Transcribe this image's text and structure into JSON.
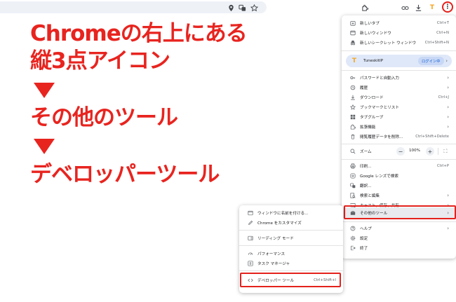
{
  "overlay": {
    "line1": "Chromeの右上にある",
    "line2": "縦3点アイコン",
    "line3": "その他のツール",
    "line4": "デベロッパーツール"
  },
  "toolbar": {
    "menu_icon_glyph": "⋮"
  },
  "menu": {
    "items_top": [
      {
        "label": "新しいタブ",
        "shortcut": "Ctrl+T",
        "icon": "new-tab-icon"
      },
      {
        "label": "新しいウィンドウ",
        "shortcut": "Ctrl+N",
        "icon": "new-window-icon"
      },
      {
        "label": "新しいシークレット ウィンドウ",
        "shortcut": "Ctrl+Shift+N",
        "icon": "incognito-icon"
      }
    ],
    "profile": {
      "name": "TuneskitIP",
      "badge": "ログイン中"
    },
    "items_mid": [
      {
        "label": "パスワードと自動入力",
        "shortcut": "",
        "arrow": "›",
        "icon": "key-icon"
      },
      {
        "label": "履歴",
        "shortcut": "",
        "arrow": "›",
        "icon": "history-icon"
      },
      {
        "label": "ダウンロード",
        "shortcut": "Ctrl+J",
        "arrow": "",
        "icon": "download-icon"
      },
      {
        "label": "ブックマークとリスト",
        "shortcut": "",
        "arrow": "›",
        "icon": "star-icon"
      },
      {
        "label": "タブグループ",
        "shortcut": "",
        "arrow": "›",
        "icon": "tab-groups-icon"
      },
      {
        "label": "拡張機能",
        "shortcut": "",
        "arrow": "›",
        "icon": "extension-icon"
      },
      {
        "label": "閲覧履歴データを削除...",
        "shortcut": "Ctrl+Shift+Delete",
        "arrow": "",
        "icon": "trash-icon"
      }
    ],
    "zoom": {
      "label": "ズーム",
      "minus": "−",
      "value": "100%",
      "plus": "+"
    },
    "items_tools": [
      {
        "label": "印刷...",
        "shortcut": "Ctrl+P",
        "arrow": "",
        "icon": "print-icon"
      },
      {
        "label": "Google レンズで検索",
        "shortcut": "",
        "arrow": "",
        "icon": "lens-icon"
      },
      {
        "label": "翻訳...",
        "shortcut": "",
        "arrow": "",
        "icon": "translate-icon"
      },
      {
        "label": "検索と編集",
        "shortcut": "",
        "arrow": "›",
        "icon": "search-edit-icon"
      },
      {
        "label": "キャスト、保存、共有",
        "shortcut": "",
        "arrow": "›",
        "icon": "cast-icon"
      },
      {
        "label": "その他のツール",
        "shortcut": "",
        "arrow": "›",
        "icon": "toolbox-icon"
      }
    ],
    "items_bottom": [
      {
        "label": "ヘルプ",
        "shortcut": "",
        "arrow": "›",
        "icon": "help-icon"
      },
      {
        "label": "設定",
        "shortcut": "",
        "arrow": "",
        "icon": "settings-icon"
      },
      {
        "label": "終了",
        "shortcut": "",
        "arrow": "",
        "icon": "exit-icon"
      }
    ]
  },
  "submenu": {
    "items": [
      {
        "label": "ウィンドウに名前を付ける...",
        "shortcut": "",
        "icon": "window-icon"
      },
      {
        "label": "Chrome をカスタマイズ",
        "shortcut": "",
        "icon": "pencil-icon"
      },
      {
        "label": "リーディング モード",
        "shortcut": "",
        "icon": "reading-mode-icon"
      },
      {
        "label": "パフォーマンス",
        "shortcut": "",
        "icon": "performance-icon"
      },
      {
        "label": "タスク マネージャ",
        "shortcut": "",
        "icon": "task-manager-icon"
      },
      {
        "label": "デベロッパー ツール",
        "shortcut": "Ctrl+Shift+I",
        "icon": "code-icon"
      }
    ]
  },
  "colors": {
    "accent": "#e8241f",
    "highlight": "#e4211c"
  }
}
